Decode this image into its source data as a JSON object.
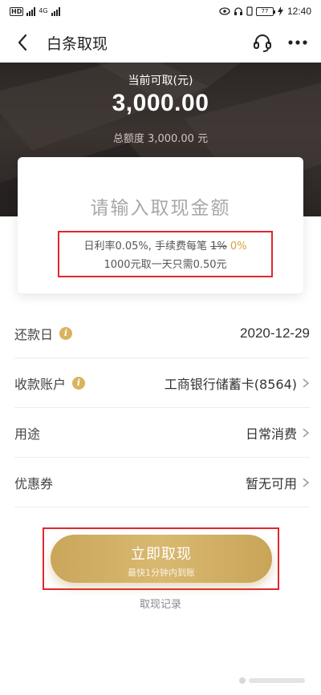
{
  "status_bar": {
    "time": "12:40",
    "battery": "77"
  },
  "nav": {
    "title": "白条取现"
  },
  "hero": {
    "label": "当前可取(元)",
    "amount": "3,000.00",
    "total": "总额度 3,000.00 元"
  },
  "card": {
    "placeholder": "请输入取现金额",
    "rate_prefix": "日利率0.05%, 手续费每笔 ",
    "rate_old": "1%",
    "rate_new": "0%",
    "rate_line2": "1000元取一天只需0.50元"
  },
  "rows": {
    "repay_label": "还款日",
    "repay_value": "2020-12-29",
    "account_label": "收款账户",
    "account_value": "工商银行储蓄卡(8564)",
    "purpose_label": "用途",
    "purpose_value": "日常消费",
    "coupon_label": "优惠券",
    "coupon_value": "暂无可用"
  },
  "button": {
    "main": "立即取现",
    "sub": "最快1分钟内到账"
  },
  "records_link": "取现记录",
  "colors": {
    "gold": "#d3a23a",
    "highlight_red": "#e0272c"
  }
}
